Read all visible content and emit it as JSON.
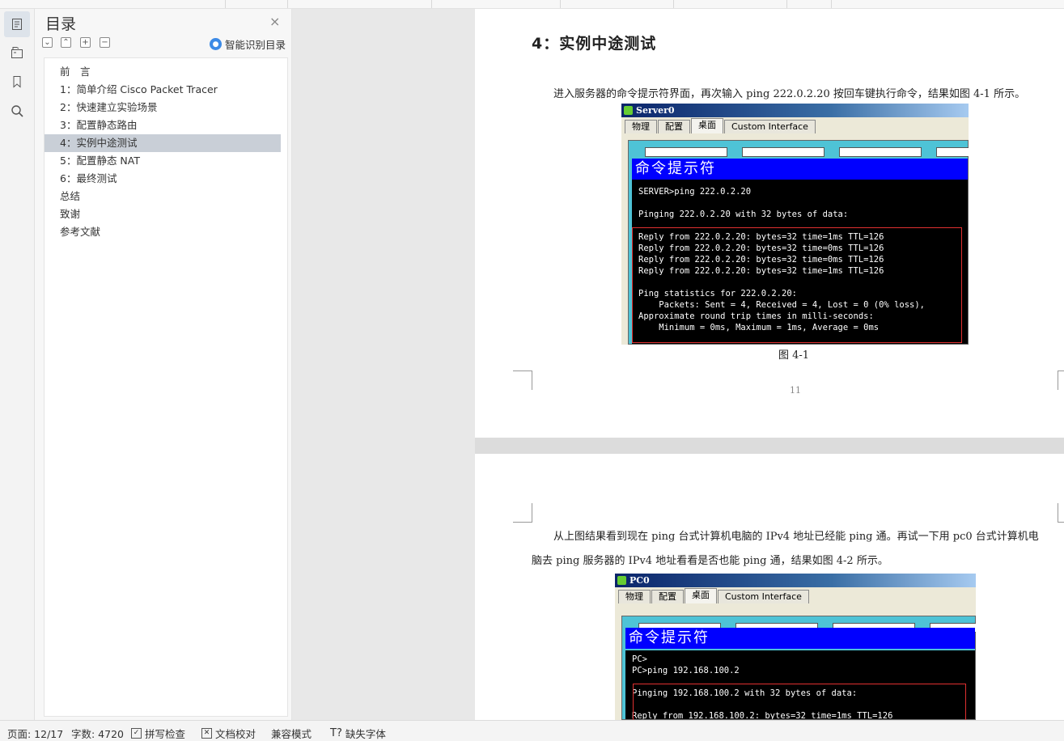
{
  "toc": {
    "title": "目录",
    "close": "×",
    "ai_label": "智能识别目录",
    "items": [
      "前　言",
      "1：简单介绍 Cisco Packet Tracer",
      "2：快速建立实验场景",
      "3：配置静态路由",
      "4：实例中途测试",
      "5：配置静态 NAT",
      "6：最终测试",
      "总结",
      "致谢",
      "参考文献"
    ],
    "selected_index": 4
  },
  "page1": {
    "heading": "4：实例中途测试",
    "para": "进入服务器的命令提示符界面，再次输入 ping 222.0.2.20 按回车键执行命令，结果如图 4-1 所示。",
    "figure": {
      "window_title": "Server0",
      "tabs": [
        "物理",
        "配置",
        "桌面",
        "Custom Interface"
      ],
      "active_tab": "桌面",
      "cmd_title": "命令提示符",
      "lines": [
        "SERVER>ping 222.0.2.20",
        "",
        "Pinging 222.0.2.20 with 32 bytes of data:",
        "",
        "Reply from 222.0.2.20: bytes=32 time=1ms TTL=126",
        "Reply from 222.0.2.20: bytes=32 time=0ms TTL=126",
        "Reply from 222.0.2.20: bytes=32 time=0ms TTL=126",
        "Reply from 222.0.2.20: bytes=32 time=1ms TTL=126",
        "",
        "Ping statistics for 222.0.2.20:",
        "    Packets: Sent = 4, Received = 4, Lost = 0 (0% loss),",
        "Approximate round trip times in milli-seconds:",
        "    Minimum = 0ms, Maximum = 1ms, Average = 0ms"
      ]
    },
    "caption": "图 4-1",
    "page_number": "11"
  },
  "page2": {
    "para_line1": "从上图结果看到现在 ping 台式计算机电脑的 IPv4 地址已经能 ping 通。再试一下用 pc0 台式计算机电",
    "para_line2": "脑去 ping 服务器的 IPv4 地址看看是否也能 ping 通，结果如图 4-2 所示。",
    "figure": {
      "window_title": "PC0",
      "tabs": [
        "物理",
        "配置",
        "桌面",
        "Custom Interface"
      ],
      "active_tab": "桌面",
      "cmd_title": "命令提示符",
      "lines": [
        "PC>",
        "PC>ping 192.168.100.2",
        "",
        "Pinging 192.168.100.2 with 32 bytes of data:",
        "",
        "Reply from 192.168.100.2: bytes=32 time=1ms TTL=126"
      ]
    }
  },
  "status": {
    "page": "页面: 12/17",
    "words": "字数: 4720",
    "spell": "拼写检查",
    "proof": "文档校对",
    "compat": "兼容模式",
    "fonts": "缺失字体"
  },
  "colors": {
    "selected_row": "#c9cfd7",
    "cmd_title_bg": "#0000ff",
    "terminal_bg": "#000000",
    "highlight_box": "#e03030"
  }
}
